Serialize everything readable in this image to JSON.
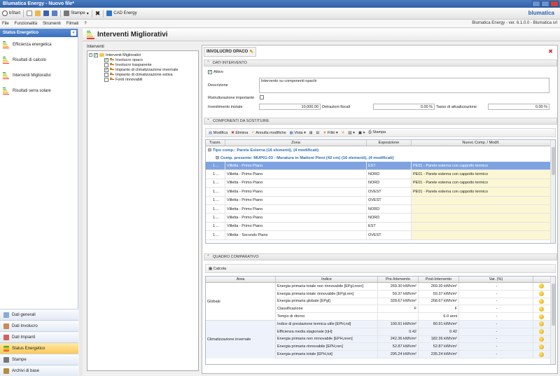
{
  "window": {
    "title": "Blumatica Energy - Nuovo file*"
  },
  "toolbar": {
    "start_label": "bStart",
    "stampe_label": "Stampe",
    "cad_label": "CAD Energy",
    "brand": "blumatica"
  },
  "menubar": {
    "items": [
      "File",
      "Funzionalità",
      "Strumenti",
      "Filmati",
      "?"
    ],
    "version": "Blumatica Energy - ver. 6.1.0.0 - Blumatica srl"
  },
  "sidebar": {
    "header": "Status Energetico",
    "collapse_glyph": "«",
    "items": [
      "Efficienza energetica",
      "Risultati di calcolo",
      "Interventi Migliorativi",
      "Risultati serra solare"
    ],
    "nav": [
      "Dati generali",
      "Dati Involucro",
      "Dati Impianti",
      "Status Energetico",
      "Stampe",
      "Archivi di base"
    ]
  },
  "main": {
    "title": "Interventi Migliorativi"
  },
  "tree": {
    "label": "Interventi",
    "root": "Interventi Migliorativi",
    "children": [
      {
        "label": "Involucro opaco",
        "checked": true
      },
      {
        "label": "Involucro trasparente",
        "checked": false
      },
      {
        "label": "Impianto di climatizzazione invernale",
        "checked": true
      },
      {
        "label": "Impianto di climatizzazione estiva",
        "checked": false
      },
      {
        "label": "Fonti rinnovabili",
        "checked": false
      }
    ]
  },
  "panel": {
    "tab": "INVOLUCRO OPACO",
    "sec_dati": "DATI INTERVENTO",
    "attivo": "Attivo",
    "descrizione_label": "Descrizione",
    "descrizione_value": "Intervento su componenti opachi",
    "ristrutt_label": "Ristrutturazione importante",
    "investimento_label": "Investimento iniziale",
    "investimento_value": "10,000.00",
    "detrazioni_label": "Detrazioni fiscali",
    "detrazioni_value": "0.00 %",
    "tasso_label": "Tasso di attualizzazione",
    "tasso_value": "0.00 %",
    "sec_comp": "COMPONENTI DA SOSTITUIRE",
    "grid_tools": [
      "Modifica",
      "Elimina",
      "Annulla modifiche",
      "Vista",
      "Filtri",
      "Stampa"
    ],
    "cols": [
      "Trasm.",
      "Zona",
      "Esposizione",
      "Nuovo Comp. / Modif."
    ],
    "group1": "Tipo comp.: Parete Esterna (16 elementi), (4 modificati)",
    "group2": "Comp. presente: MUP01-03 - Muratura in Mattoni Pieni (42 cm) (16 elementi), (4 modificati)",
    "rows": [
      {
        "t": "1....",
        "zona": "Villetta - Primo Piano",
        "esp": "EST",
        "nuovo": "PE01 - Parete esterna con cappotto termico"
      },
      {
        "t": "1....",
        "zona": "Villetta - Primo Piano",
        "esp": "NORD",
        "nuovo": "PE01 - Parete esterna con cappotto termico"
      },
      {
        "t": "1....",
        "zona": "Villetta - Primo Piano",
        "esp": "NORD",
        "nuovo": "PE01 - Parete esterna con cappotto termico"
      },
      {
        "t": "1....",
        "zona": "Villetta - Primo Piano",
        "esp": "OVEST",
        "nuovo": "PE01 - Parete esterna con cappotto termico"
      },
      {
        "t": "1....",
        "zona": "Villetta - Primo Piano",
        "esp": "OVEST",
        "nuovo": ""
      },
      {
        "t": "1....",
        "zona": "Villetta - Primo Piano",
        "esp": "NORD",
        "nuovo": ""
      },
      {
        "t": "1....",
        "zona": "Villetta - Primo Piano",
        "esp": "NORD",
        "nuovo": ""
      },
      {
        "t": "1....",
        "zona": "Villetta - Primo Piano",
        "esp": "EST",
        "nuovo": ""
      },
      {
        "t": "1....",
        "zona": "Villetta - Secondo Piano",
        "esp": "OVEST",
        "nuovo": ""
      }
    ],
    "sec_quadro": "QUADRO COMPARATIVO",
    "calcola": "Calcola",
    "qcols": [
      "Area",
      "Indice",
      "Pre-Intervento",
      "Post-Intervento",
      "Var. (%)"
    ],
    "area_globale": "Globale",
    "area_inv": "Climatizzazione invernale",
    "qrows": [
      {
        "indice": "Energia primaria totale non rinnovabile [EPgl,nren]",
        "pre": "269.30 kWh/m²",
        "post": "269.30 kWh/m²",
        "var": "-"
      },
      {
        "indice": "Energia primaria totale rinnovabile [EPgl,ren]",
        "pre": "59.37 kWh/m²",
        "post": "59.37 kWh/m²",
        "var": "-"
      },
      {
        "indice": "Energia primaria globale [EPgl]",
        "pre": "328.67 kWh/m²",
        "post": "268.67 kWh/m²",
        "var": "-"
      },
      {
        "indice": "Classificazione",
        "pre": "F",
        "post": "F",
        "var": "-"
      },
      {
        "indice": "Tempo di ritorno",
        "pre": "",
        "post": "6.0 anni",
        "var": "-"
      },
      {
        "indice": "Indice di prestazione termica utile [EPH,nd]",
        "pre": "100.91 kWh/m²",
        "post": "80.91 kWh/m²",
        "var": "-"
      },
      {
        "indice": "Efficienza media stagionale [ηH]",
        "pre": "0.42",
        "post": "0.42",
        "var": "-"
      },
      {
        "indice": "Energia primaria non rinnovabile [EPH,nren]",
        "pre": "242.36 kWh/m²",
        "post": "182.36 kWh/m²",
        "var": "-"
      },
      {
        "indice": "Energia primaria rinnovabile [EPH,ren]",
        "pre": "52.87 kWh/m²",
        "post": "52.87 kWh/m²",
        "var": "-"
      },
      {
        "indice": "Energia primaria totale [EPH,tot]",
        "pre": "295.24 kWh/m²",
        "post": "235.24 kWh/m²",
        "var": "-"
      }
    ]
  }
}
